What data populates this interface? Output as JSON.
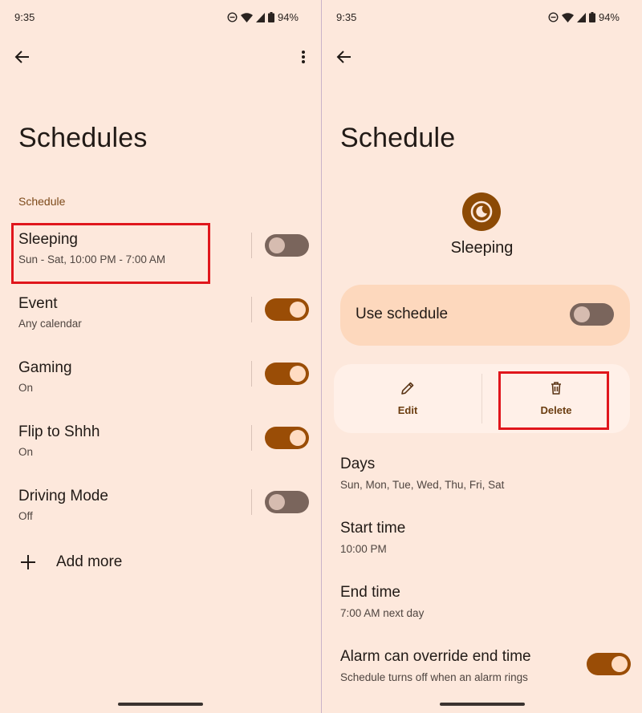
{
  "left": {
    "status": {
      "time": "9:35",
      "battery": "94%"
    },
    "title": "Schedules",
    "section_label": "Schedule",
    "rows": [
      {
        "title": "Sleeping",
        "subtitle": "Sun - Sat, 10:00 PM - 7:00 AM",
        "enabled": false
      },
      {
        "title": "Event",
        "subtitle": "Any calendar",
        "enabled": true
      },
      {
        "title": "Gaming",
        "subtitle": "On",
        "enabled": true
      },
      {
        "title": "Flip to Shhh",
        "subtitle": "On",
        "enabled": true
      },
      {
        "title": "Driving Mode",
        "subtitle": "Off",
        "enabled": false
      }
    ],
    "add_more": "Add more"
  },
  "right": {
    "status": {
      "time": "9:35",
      "battery": "94%"
    },
    "title": "Schedule",
    "schedule_name": "Sleeping",
    "use_schedule": {
      "label": "Use schedule",
      "enabled": false
    },
    "edit_label": "Edit",
    "delete_label": "Delete",
    "days": {
      "title": "Days",
      "value": "Sun, Mon, Tue, Wed, Thu, Fri, Sat"
    },
    "start_time": {
      "title": "Start time",
      "value": "10:00 PM"
    },
    "end_time": {
      "title": "End time",
      "value": "7:00 AM next day"
    },
    "alarm_override": {
      "title": "Alarm can override end time",
      "value": "Schedule turns off when an alarm rings",
      "enabled": true
    }
  },
  "colors": {
    "background": "#fde8dc",
    "accent": "#9a4d06",
    "highlight_box": "#e0161c",
    "card": "#fdd8bd"
  },
  "icons": [
    "back-arrow-icon",
    "more-vert-icon",
    "plus-icon",
    "moon-clock-icon",
    "pencil-icon",
    "trash-icon",
    "dnd-icon",
    "wifi-icon",
    "signal-icon",
    "battery-icon"
  ]
}
